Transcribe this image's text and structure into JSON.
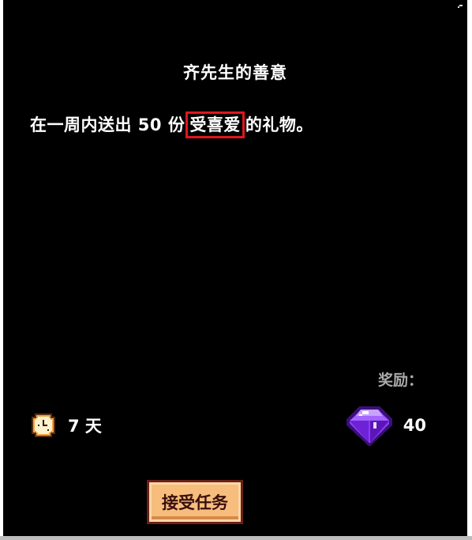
{
  "quest": {
    "title": "齐先生的善意",
    "description_before": "在一周内送出 50 份",
    "description_highlight": "受喜爱",
    "description_after": "的礼物。",
    "time_icon": "clock-icon",
    "time_text": "7 天",
    "reward_label": "奖励：",
    "reward_icon": "purple-gem-icon",
    "reward_value": "40",
    "accept_label": "接受任务"
  },
  "colors": {
    "background": "#000000",
    "text": "#ffffff",
    "reward_label": "#a9a9a9",
    "highlight_border": "#e0161d",
    "button_fill": "#f6bd7d",
    "button_border": "#6b1f1a",
    "gem": "#8a3cf0"
  }
}
